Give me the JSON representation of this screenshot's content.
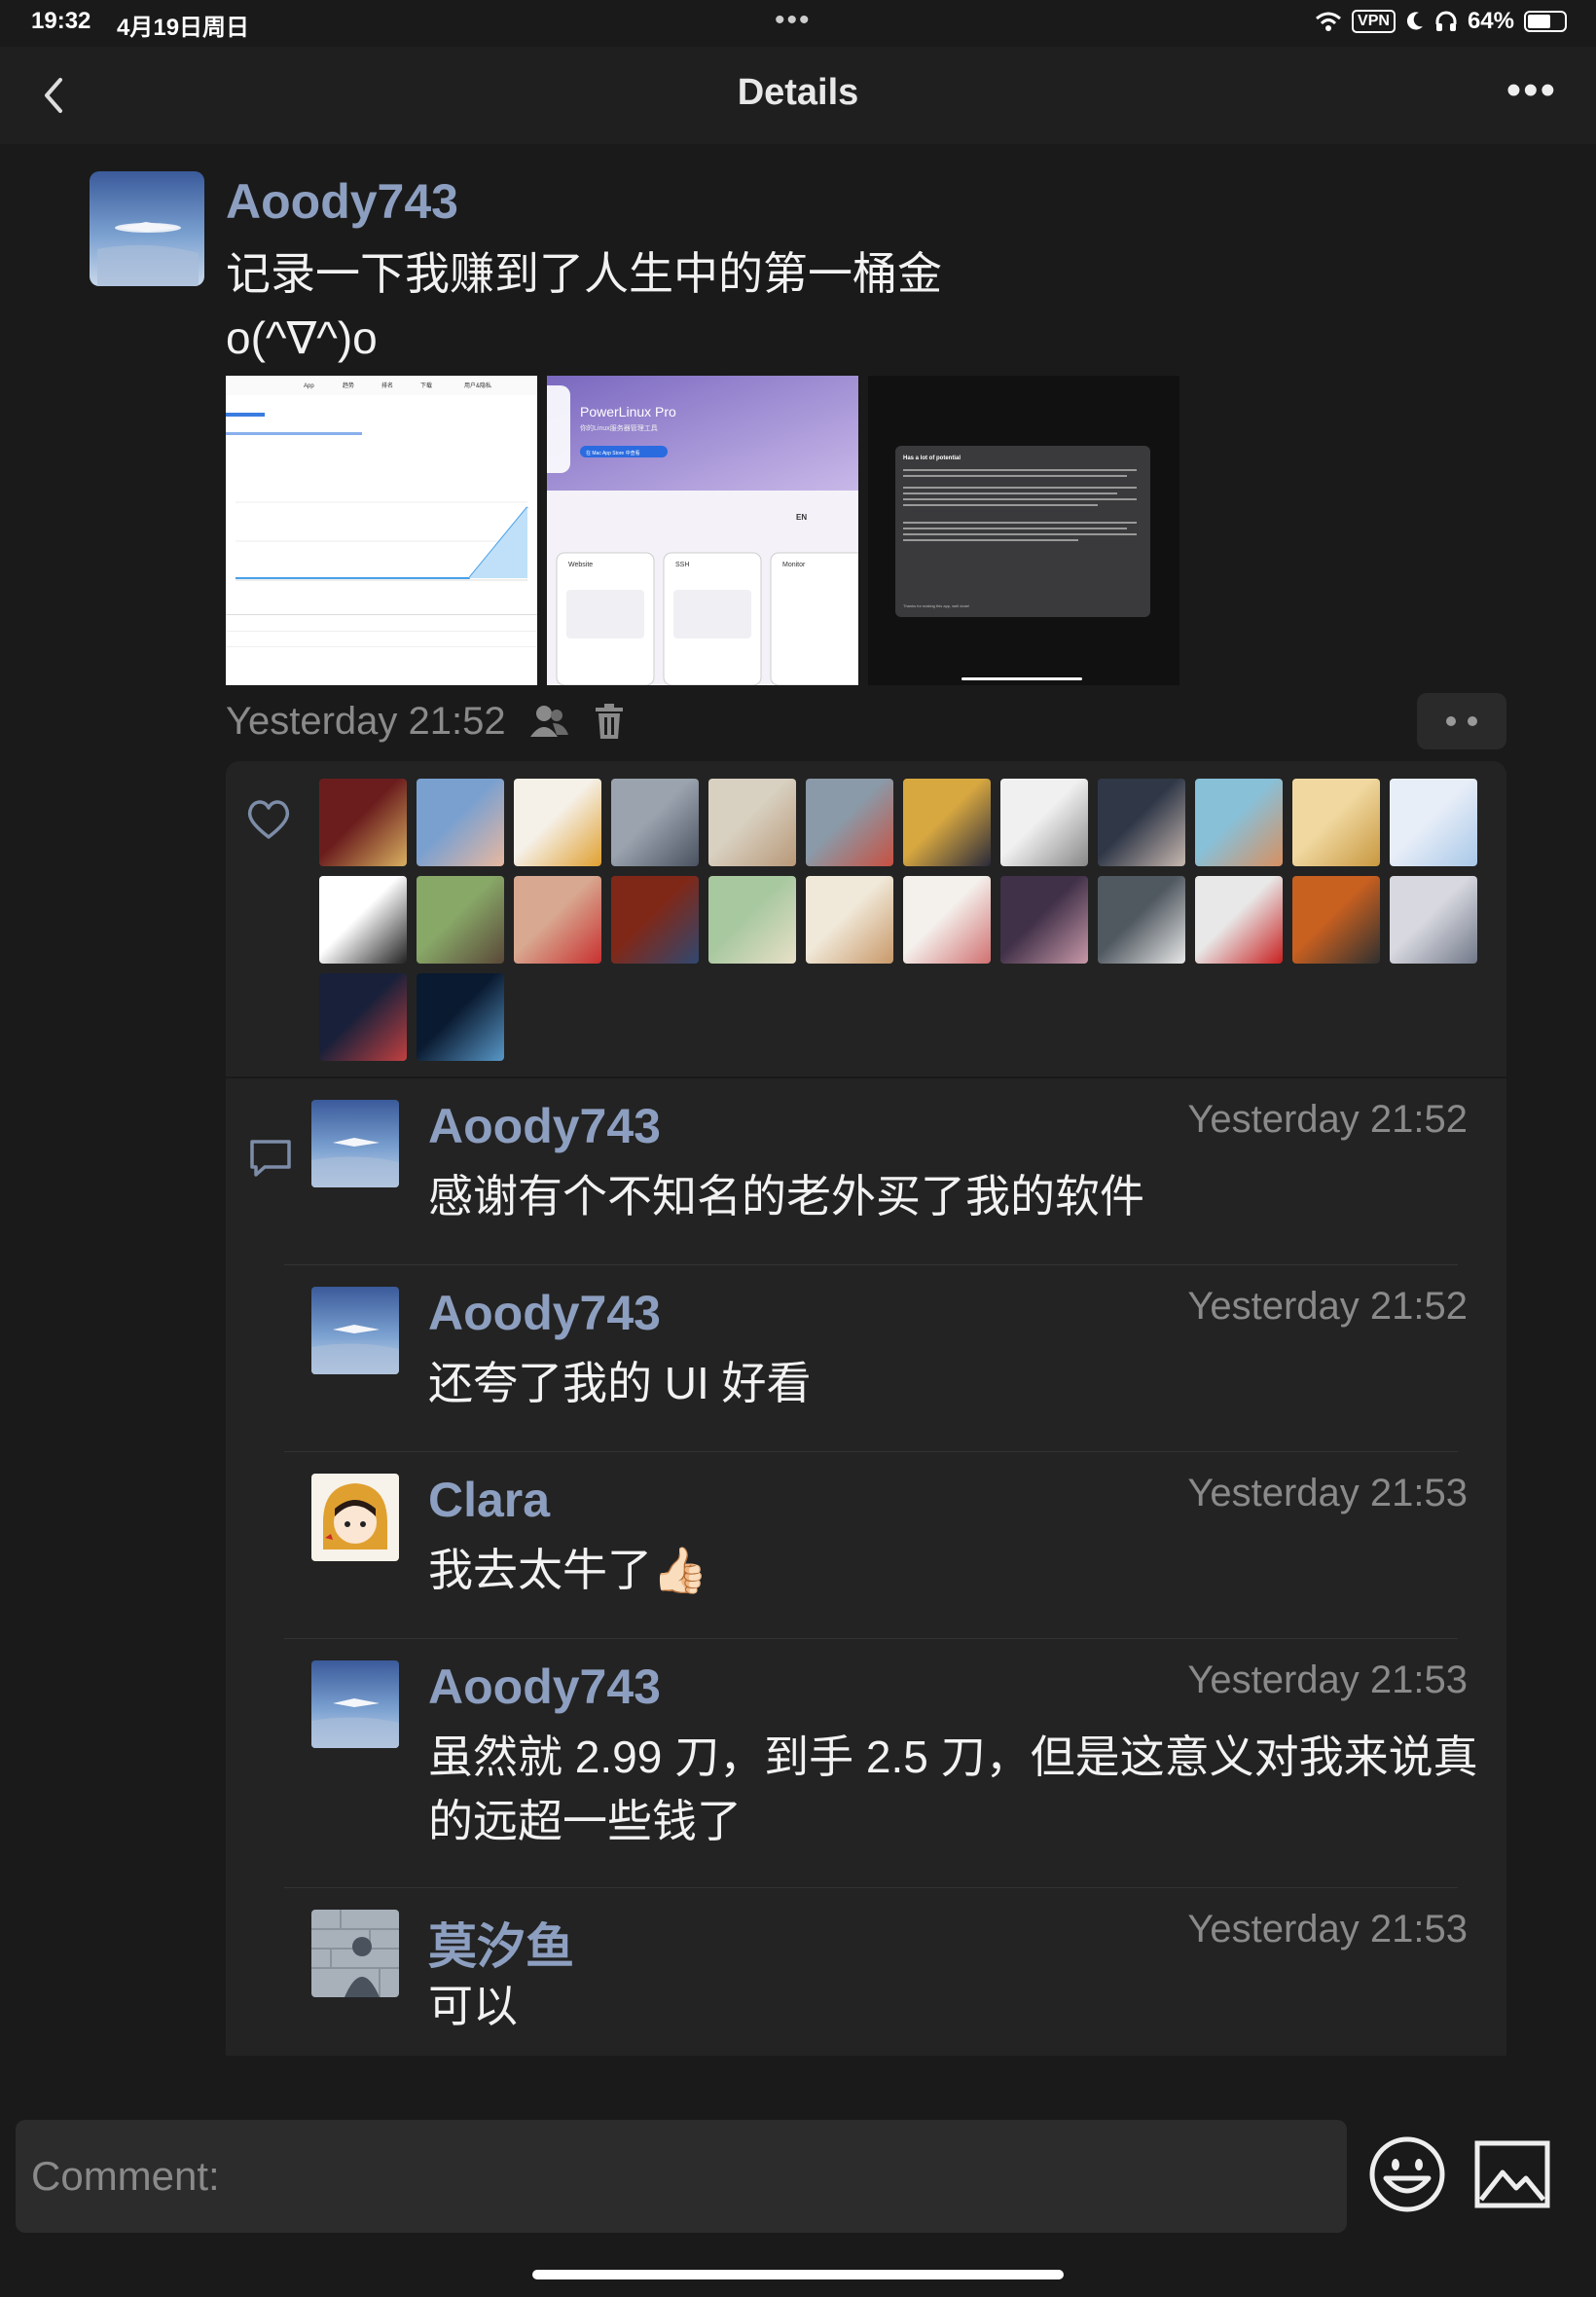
{
  "status_bar": {
    "time": "19:32",
    "date": "4月19日周日",
    "vpn": "VPN",
    "battery": "64%",
    "battery_level": 0.64
  },
  "nav": {
    "title": "Details"
  },
  "post": {
    "author": "Aoody743",
    "text": "记录一下我赚到了人生中的第一桶金\no(^∇^)o",
    "time": "Yesterday 21:52",
    "images": [
      {
        "header_tabs": [
          "App",
          "趋势",
          "排名",
          "下载",
          "用户&隐私"
        ]
      },
      {
        "title": "PowerLinux Pro",
        "subtitle": "你的Linux服务器管理工具",
        "button": "在 Mac App Store 中查看",
        "cards": [
          "Website",
          "SSH",
          "Monitor"
        ],
        "lang": "EN"
      },
      {
        "review_title": "Has a lot of potential",
        "review_body": "Still trying things out but this app is really unique. I like the UI/UX more than all the other bookmarkable server apps out there.",
        "closing": "Thanks for making this app, well done!"
      }
    ]
  },
  "likes": {
    "count": 26,
    "avatars": [
      {
        "name": "avatar-christmas",
        "c1": "#6b1d1d",
        "c2": "#d8b060"
      },
      {
        "name": "avatar-child",
        "c1": "#7aa0d0",
        "c2": "#e8b8a0"
      },
      {
        "name": "avatar-clara",
        "c1": "#f5f0e8",
        "c2": "#e0a030"
      },
      {
        "name": "avatar-shadow-wall",
        "c1": "#9aa3ae",
        "c2": "#4a5260"
      },
      {
        "name": "avatar-hamster",
        "c1": "#d8d0c0",
        "c2": "#b89878"
      },
      {
        "name": "avatar-runner",
        "c1": "#8a9aa8",
        "c2": "#c85040"
      },
      {
        "name": "avatar-cat-cartoon",
        "c1": "#d8a840",
        "c2": "#2a2a3a"
      },
      {
        "name": "avatar-rabbit-sketch",
        "c1": "#f0f0f0",
        "c2": "#888888"
      },
      {
        "name": "avatar-girl-scarf",
        "c1": "#303848",
        "c2": "#c8b8b0"
      },
      {
        "name": "avatar-diver",
        "c1": "#88c0d8",
        "c2": "#d89060"
      },
      {
        "name": "avatar-golden-bloom",
        "c1": "#f0d8a0",
        "c2": "#c89840"
      },
      {
        "name": "avatar-cinnamoroll",
        "c1": "#e8eef8",
        "c2": "#a8c8e8"
      },
      {
        "name": "avatar-eyo-logo",
        "c1": "#ffffff",
        "c2": "#222222"
      },
      {
        "name": "avatar-girl-field",
        "c1": "#88a868",
        "c2": "#5a4838"
      },
      {
        "name": "avatar-selfie",
        "c1": "#d8a890",
        "c2": "#c83030"
      },
      {
        "name": "avatar-rain-lights",
        "c1": "#802818",
        "c2": "#304870"
      },
      {
        "name": "avatar-watercolor",
        "c1": "#a8c8a0",
        "c2": "#e8e0c8"
      },
      {
        "name": "avatar-bunnies",
        "c1": "#f0e8d8",
        "c2": "#c89868"
      },
      {
        "name": "avatar-couple-dog",
        "c1": "#f4f0ec",
        "c2": "#d07070"
      },
      {
        "name": "avatar-purple-hat",
        "c1": "#403048",
        "c2": "#c898a8"
      },
      {
        "name": "avatar-sportscar",
        "c1": "#505860",
        "c2": "#e8e8e8"
      },
      {
        "name": "avatar-red-horse",
        "c1": "#e8e8e8",
        "c2": "#c82020"
      },
      {
        "name": "avatar-orange-car",
        "c1": "#c86020",
        "c2": "#303030"
      },
      {
        "name": "avatar-anime-boy",
        "c1": "#d8d8e0",
        "c2": "#707888"
      },
      {
        "name": "avatar-fireworks",
        "c1": "#18203a",
        "c2": "#c04040"
      },
      {
        "name": "avatar-lantern-girl",
        "c1": "#0a1a30",
        "c2": "#5898c8"
      }
    ]
  },
  "comments": [
    {
      "author": "Aoody743",
      "time": "Yesterday 21:52",
      "text": "感谢有个不知名的老外买了我的软件",
      "avatar": "plane"
    },
    {
      "author": "Aoody743",
      "time": "Yesterday 21:52",
      "text": "还夸了我的 UI 好看",
      "avatar": "plane"
    },
    {
      "author": "Clara",
      "time": "Yesterday 21:53",
      "text": "我去太牛了👍🏻",
      "avatar": "clara"
    },
    {
      "author": "Aoody743",
      "time": "Yesterday 21:53",
      "text": "虽然就 2.99 刀，到手 2.5 刀，但是这意义对我来说真的远超一些钱了",
      "avatar": "plane"
    },
    {
      "author": "莫汐鱼",
      "time": "Yesterday 21:53",
      "text": "可以",
      "avatar": "shadow"
    }
  ],
  "composer": {
    "placeholder": "Comment:"
  }
}
